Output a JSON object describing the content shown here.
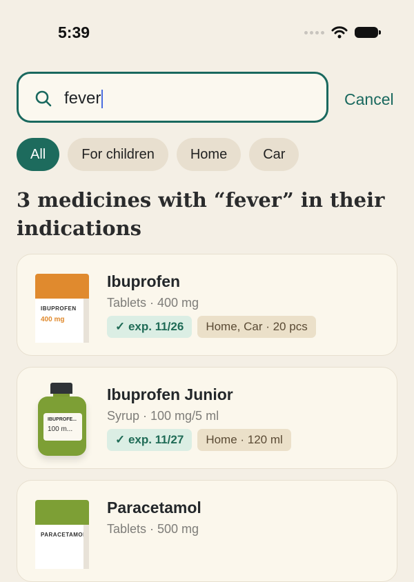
{
  "status_bar": {
    "time": "5:39"
  },
  "search": {
    "value": "fever",
    "cancel_label": "Cancel"
  },
  "filters": [
    {
      "label": "All",
      "active": true
    },
    {
      "label": "For children",
      "active": false
    },
    {
      "label": "Home",
      "active": false
    },
    {
      "label": "Car",
      "active": false
    }
  ],
  "results_heading": "3 medicines with “fever” in their indications",
  "results": [
    {
      "name": "Ibuprofen",
      "subtitle": "Tablets · 400 mg",
      "expiry": "✓ exp. 11/26",
      "location": "Home, Car · 20 pcs",
      "package": {
        "kind": "box",
        "color": "#e08a2e",
        "label": "IBUPROFEN",
        "dose": "400 mg"
      }
    },
    {
      "name": "Ibuprofen Junior",
      "subtitle": "Syrup · 100 mg/5 ml",
      "expiry": "✓ exp. 11/27",
      "location": "Home · 120 ml",
      "package": {
        "kind": "bottle",
        "color": "#7d9f35",
        "label": "IBUPROFE...",
        "dose": "100 m..."
      }
    },
    {
      "name": "Paracetamol",
      "subtitle": "Tablets · 500 mg",
      "package": {
        "kind": "box",
        "color": "#7d9f35",
        "label": "PARACETAMOL"
      }
    }
  ],
  "colors": {
    "accent": "#19685e",
    "background": "#f4efe5",
    "card": "#fbf7ec"
  }
}
